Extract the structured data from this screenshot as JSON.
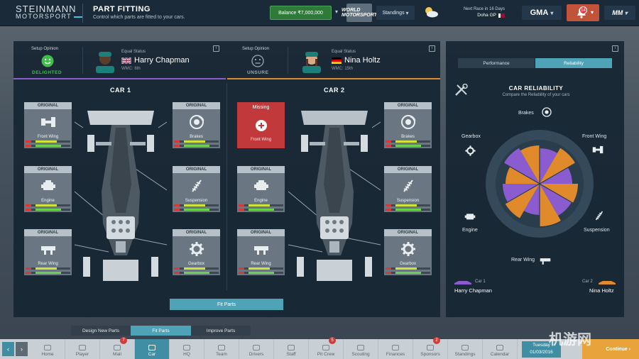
{
  "header": {
    "logo_line1": "STEINMANN",
    "logo_line2": "MOTORSPORT",
    "title": "PART FITTING",
    "subtitle": "Control which parts are fitted to your cars.",
    "balance": "Balance ₹7,000,000",
    "world_label": "WORLD MOTORSPORT",
    "standings": "Standings",
    "next_race": "Next Race in 16 Days",
    "next_race_gp": "Doha GP",
    "gma": "GMA",
    "notifications": "14",
    "mm": "MM"
  },
  "drivers": [
    {
      "setup_label": "Setup Opinion",
      "opinion": "DELIGHTED",
      "opinion_color": "#3fbf4a",
      "status": "Equal Status",
      "name": "Harry Chapman",
      "wmc": "WMC: 6th",
      "flag": "uk"
    },
    {
      "setup_label": "Setup Opinion",
      "opinion": "UNSURE",
      "opinion_color": "#9aa8b2",
      "status": "Equal Status",
      "name": "Nina Holtz",
      "wmc": "WMC: 15th",
      "flag": "de"
    }
  ],
  "cars": [
    {
      "title": "CAR 1",
      "parts": [
        {
          "cond": "ORIGINAL",
          "name": "Front Wing",
          "icon": "front-wing-icon"
        },
        {
          "cond": "ORIGINAL",
          "name": "Brakes",
          "icon": "brakes-icon"
        },
        {
          "cond": "ORIGINAL",
          "name": "Engine",
          "icon": "engine-icon"
        },
        {
          "cond": "ORIGINAL",
          "name": "Suspension",
          "icon": "suspension-icon"
        },
        {
          "cond": "ORIGINAL",
          "name": "Rear Wing",
          "icon": "rear-wing-icon"
        },
        {
          "cond": "ORIGINAL",
          "name": "Gearbox",
          "icon": "gearbox-icon"
        }
      ]
    },
    {
      "title": "CAR 2",
      "parts": [
        {
          "cond": "Missing",
          "name": "Front Wing",
          "icon": "add-icon"
        },
        {
          "cond": "ORIGINAL",
          "name": "Brakes",
          "icon": "brakes-icon"
        },
        {
          "cond": "ORIGINAL",
          "name": "Engine",
          "icon": "engine-icon"
        },
        {
          "cond": "ORIGINAL",
          "name": "Suspension",
          "icon": "suspension-icon"
        },
        {
          "cond": "ORIGINAL",
          "name": "Rear Wing",
          "icon": "rear-wing-icon"
        },
        {
          "cond": "ORIGINAL",
          "name": "Gearbox",
          "icon": "gearbox-icon"
        }
      ]
    }
  ],
  "fit_button": "Fit Parts",
  "reliability": {
    "tab_performance": "Performance",
    "tab_reliability": "Reliability",
    "title": "CAR RELIABILITY",
    "subtitle": "Compare the Reliability of your cars",
    "labels": {
      "brakes": "Brakes",
      "front_wing": "Front Wing",
      "suspension": "Suspension",
      "rear_wing": "Rear Wing",
      "engine": "Engine",
      "gearbox": "Gearbox"
    },
    "car1_label": "Car 1",
    "car1_driver": "Harry Chapman",
    "car2_label": "Car 2",
    "car2_driver": "Nina Holtz",
    "car1_color": "#8b5bd0",
    "car2_color": "#e08a2c"
  },
  "subtabs": [
    "Design New Parts",
    "Fit Parts",
    "Improve Parts"
  ],
  "nav": [
    {
      "label": "Home"
    },
    {
      "label": "Player"
    },
    {
      "label": "Mail",
      "badge": "7"
    },
    {
      "label": "Car"
    },
    {
      "label": "HQ"
    },
    {
      "label": "Team"
    },
    {
      "label": "Drivers"
    },
    {
      "label": "Staff"
    },
    {
      "label": "Pit Crew",
      "badge": "5"
    },
    {
      "label": "Scouting"
    },
    {
      "label": "Finances"
    },
    {
      "label": "Sponsors",
      "badge": "2"
    },
    {
      "label": "Standings"
    },
    {
      "label": "Calendar"
    }
  ],
  "date": {
    "day": "Tuesday",
    "date": "01/03/2016"
  },
  "continue": "Continue",
  "watermark": "机游网"
}
